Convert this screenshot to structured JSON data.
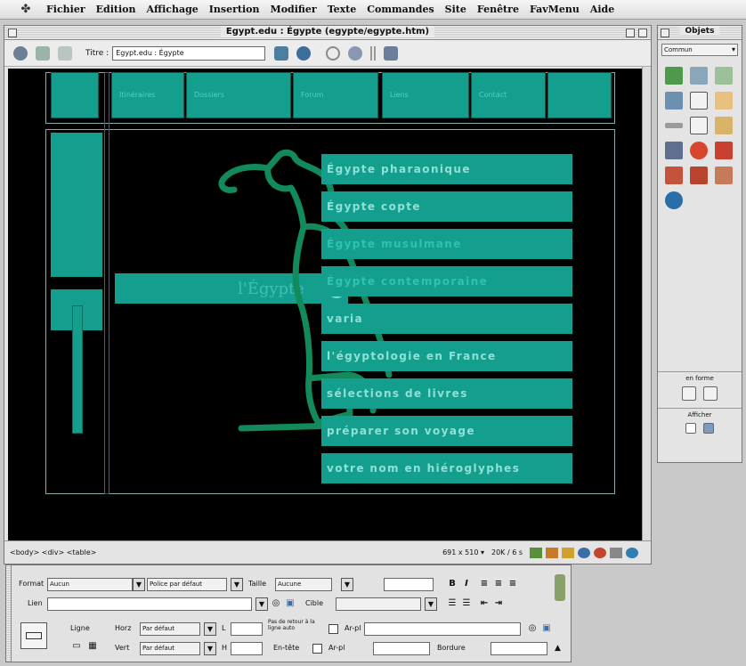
{
  "menubar": {
    "items": [
      "Fichier",
      "Edition",
      "Affichage",
      "Insertion",
      "Modifier",
      "Texte",
      "Commandes",
      "Site",
      "Fenêtre",
      "FavMenu",
      "Aide"
    ]
  },
  "document": {
    "window_title": "Egypt.edu : Égypte (egypte/egypte.htm)",
    "title_label": "Titre :",
    "title_value": "Egypt.edu : Égypte",
    "tag_path": "<body> <div> <table>",
    "size_readout": "691 x 510 ▾",
    "download_readout": "20K / 6 s"
  },
  "page": {
    "brand_label": "l'Égypte",
    "menu_items": [
      "Égypte pharaonique",
      "Égypte copte",
      "Égypte musulmane",
      "Égypte contemporaine",
      "varia",
      "l'égyptologie en France",
      "sélections de livres",
      "préparer son voyage",
      "votre nom en hiéroglyphes"
    ],
    "top_nav": [
      "",
      "Itinéraires",
      "Dossiers",
      "Forum",
      "Liens",
      "Contact",
      ""
    ]
  },
  "objects_panel": {
    "title": "Objets",
    "category": "Commun",
    "section_forms": "en forme",
    "section_show": "Afficher"
  },
  "properties": {
    "format_label": "Format",
    "format_value": "Aucun",
    "font_value": "Police par défaut",
    "size_label": "Taille",
    "size_value": "Aucune",
    "link_label": "Lien",
    "target_label": "Cible",
    "row_label": "Ligne",
    "horz_label": "Horz",
    "horz_value": "Par défaut",
    "vert_label": "Vert",
    "vert_value": "Par défaut",
    "w_label": "L",
    "h_label": "H",
    "nowrap_label": "Pas de retour à la ligne auto",
    "header_label": "En-tête",
    "bg_label": "Ar-pl",
    "border_label": "Bordure",
    "bold": "B",
    "italic": "I"
  },
  "colors": {
    "teal": "#149e8e",
    "teal_text": "#8fe0d6",
    "ibis_green": "#138a5c",
    "canvas_bg": "#000000"
  }
}
